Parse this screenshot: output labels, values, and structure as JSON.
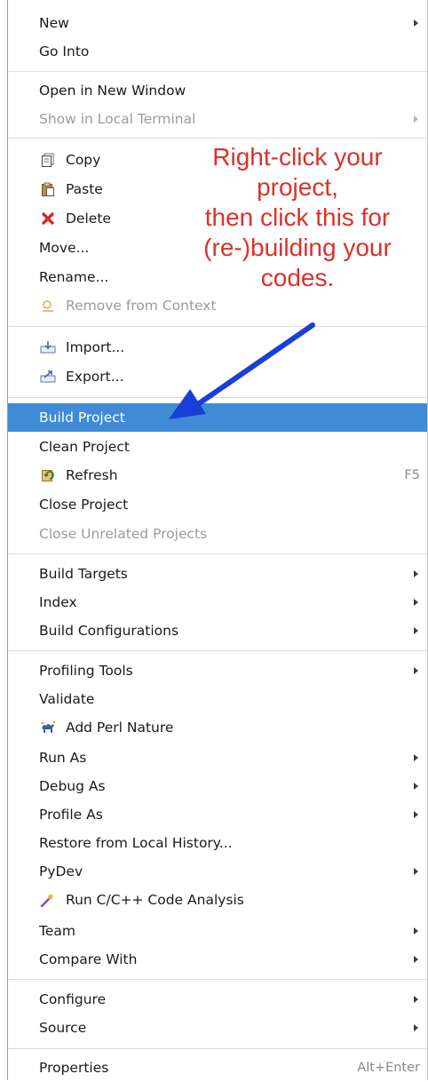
{
  "menu": {
    "new": "New",
    "go_into": "Go Into",
    "open_new_window": "Open in New Window",
    "show_local_terminal": "Show in Local Terminal",
    "copy": "Copy",
    "paste": "Paste",
    "delete": "Delete",
    "move": "Move...",
    "rename": "Rename...",
    "remove_from_context": "Remove from Context",
    "import": "Import...",
    "export": "Export...",
    "build_project": "Build Project",
    "clean_project": "Clean Project",
    "refresh": "Refresh",
    "refresh_shortcut": "F5",
    "close_project": "Close Project",
    "close_unrelated": "Close Unrelated Projects",
    "build_targets": "Build Targets",
    "index": "Index",
    "build_configurations": "Build Configurations",
    "profiling_tools": "Profiling Tools",
    "validate": "Validate",
    "add_perl_nature": "Add Perl Nature",
    "run_as": "Run As",
    "debug_as": "Debug As",
    "profile_as": "Profile As",
    "restore_local_history": "Restore from Local History...",
    "pydev": "PyDev",
    "run_code_analysis": "Run C/C++ Code Analysis",
    "team": "Team",
    "compare_with": "Compare With",
    "configure": "Configure",
    "source": "Source",
    "properties": "Properties",
    "properties_shortcut": "Alt+Enter"
  },
  "annotation": {
    "line1": "Right-click your",
    "line2": "project,",
    "line3": "then click this for",
    "line4": "(re-)building your",
    "line5": "codes."
  },
  "colors": {
    "selection": "#3f8bd6",
    "annotation_text": "#d9322a",
    "arrow": "#1a3fd6"
  }
}
